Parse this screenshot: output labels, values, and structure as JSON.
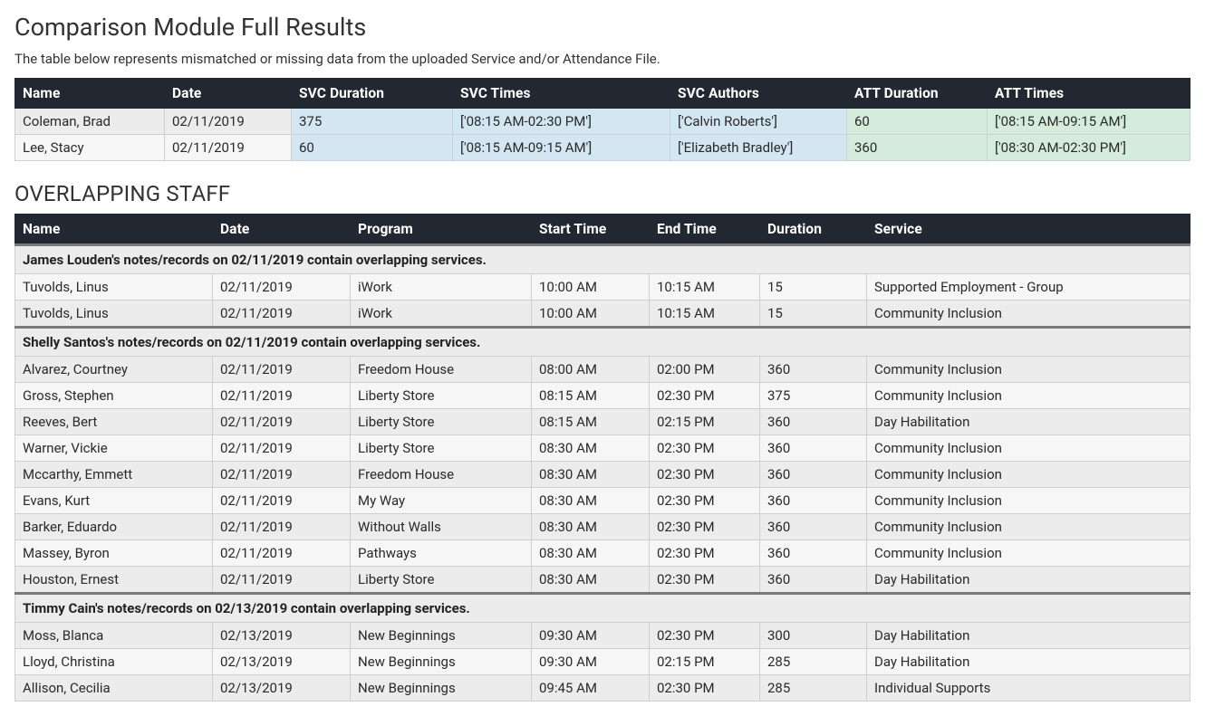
{
  "header": {
    "title": "Comparison Module Full Results",
    "subtitle": "The table below represents mismatched or missing data from the uploaded Service and/or Attendance File."
  },
  "comparison": {
    "columns": [
      "Name",
      "Date",
      "SVC Duration",
      "SVC Times",
      "SVC Authors",
      "ATT Duration",
      "ATT Times"
    ],
    "highlight_columns": {
      "blue": [
        2,
        3,
        4
      ],
      "green": [
        5,
        6
      ]
    },
    "rows": [
      {
        "name": "Coleman, Brad",
        "date": "02/11/2019",
        "svc_duration": "375",
        "svc_times": "['08:15 AM-02:30 PM']",
        "svc_authors": "['Calvin Roberts']",
        "att_duration": "60",
        "att_times": "['08:15 AM-09:15 AM']"
      },
      {
        "name": "Lee, Stacy",
        "date": "02/11/2019",
        "svc_duration": "60",
        "svc_times": "['08:15 AM-09:15 AM']",
        "svc_authors": "['Elizabeth Bradley']",
        "att_duration": "360",
        "att_times": "['08:30 AM-02:30 PM']"
      }
    ]
  },
  "overlapping": {
    "title": "OVERLAPPING STAFF",
    "columns": [
      "Name",
      "Date",
      "Program",
      "Start Time",
      "End Time",
      "Duration",
      "Service"
    ],
    "groups": [
      {
        "label": "James Louden's notes/records on 02/11/2019 contain overlapping services.",
        "rows": [
          {
            "name": "Tuvolds, Linus",
            "date": "02/11/2019",
            "program": "iWork",
            "start": "10:00 AM",
            "end": "10:15 AM",
            "duration": "15",
            "service": "Supported Employment - Group"
          },
          {
            "name": "Tuvolds, Linus",
            "date": "02/11/2019",
            "program": "iWork",
            "start": "10:00 AM",
            "end": "10:15 AM",
            "duration": "15",
            "service": "Community Inclusion"
          }
        ]
      },
      {
        "label": "Shelly Santos's notes/records on 02/11/2019 contain overlapping services.",
        "rows": [
          {
            "name": "Alvarez, Courtney",
            "date": "02/11/2019",
            "program": "Freedom House",
            "start": "08:00 AM",
            "end": "02:00 PM",
            "duration": "360",
            "service": "Community Inclusion"
          },
          {
            "name": "Gross, Stephen",
            "date": "02/11/2019",
            "program": "Liberty Store",
            "start": "08:15 AM",
            "end": "02:30 PM",
            "duration": "375",
            "service": "Community Inclusion"
          },
          {
            "name": "Reeves, Bert",
            "date": "02/11/2019",
            "program": "Liberty Store",
            "start": "08:15 AM",
            "end": "02:15 PM",
            "duration": "360",
            "service": "Day Habilitation"
          },
          {
            "name": "Warner, Vickie",
            "date": "02/11/2019",
            "program": "Liberty Store",
            "start": "08:30 AM",
            "end": "02:30 PM",
            "duration": "360",
            "service": "Community Inclusion"
          },
          {
            "name": "Mccarthy, Emmett",
            "date": "02/11/2019",
            "program": "Freedom House",
            "start": "08:30 AM",
            "end": "02:30 PM",
            "duration": "360",
            "service": "Community Inclusion"
          },
          {
            "name": "Evans, Kurt",
            "date": "02/11/2019",
            "program": "My Way",
            "start": "08:30 AM",
            "end": "02:30 PM",
            "duration": "360",
            "service": "Community Inclusion"
          },
          {
            "name": "Barker, Eduardo",
            "date": "02/11/2019",
            "program": "Without Walls",
            "start": "08:30 AM",
            "end": "02:30 PM",
            "duration": "360",
            "service": "Community Inclusion"
          },
          {
            "name": "Massey, Byron",
            "date": "02/11/2019",
            "program": "Pathways",
            "start": "08:30 AM",
            "end": "02:30 PM",
            "duration": "360",
            "service": "Community Inclusion"
          },
          {
            "name": "Houston, Ernest",
            "date": "02/11/2019",
            "program": "Liberty Store",
            "start": "08:30 AM",
            "end": "02:30 PM",
            "duration": "360",
            "service": "Day Habilitation"
          }
        ]
      },
      {
        "label": "Timmy Cain's notes/records on 02/13/2019 contain overlapping services.",
        "rows": [
          {
            "name": "Moss, Blanca",
            "date": "02/13/2019",
            "program": "New Beginnings",
            "start": "09:30 AM",
            "end": "02:30 PM",
            "duration": "300",
            "service": "Day Habilitation"
          },
          {
            "name": "Lloyd, Christina",
            "date": "02/13/2019",
            "program": "New Beginnings",
            "start": "09:30 AM",
            "end": "02:15 PM",
            "duration": "285",
            "service": "Day Habilitation"
          },
          {
            "name": "Allison, Cecilia",
            "date": "02/13/2019",
            "program": "New Beginnings",
            "start": "09:45 AM",
            "end": "02:30 PM",
            "duration": "285",
            "service": "Individual Supports"
          }
        ]
      }
    ]
  }
}
